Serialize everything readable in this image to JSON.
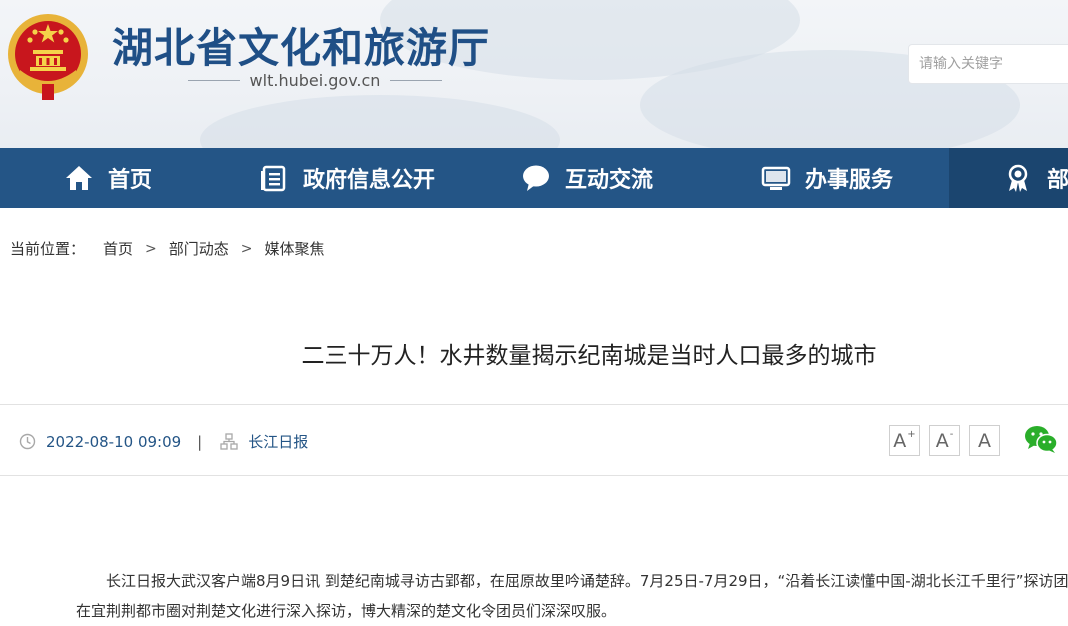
{
  "header": {
    "title": "湖北省文化和旅游厅",
    "domain": "wlt.hubei.gov.cn",
    "search_placeholder": "请输入关键字"
  },
  "nav": {
    "items": [
      {
        "label": "首页",
        "icon": "home-icon"
      },
      {
        "label": "政府信息公开",
        "icon": "document-list-icon"
      },
      {
        "label": "互动交流",
        "icon": "chat-bubble-icon"
      },
      {
        "label": "办事服务",
        "icon": "monitor-icon"
      },
      {
        "label": "部",
        "icon": "award-badge-icon"
      }
    ]
  },
  "breadcrumb": {
    "label": "当前位置：",
    "items": [
      "首页",
      "部门动态",
      "媒体聚焦"
    ],
    "separator": ">"
  },
  "article": {
    "title": "二三十万人！水井数量揭示纪南城是当时人口最多的城市",
    "datetime": "2022-08-10 09:09",
    "meta_separator": "|",
    "source": "长江日报",
    "font_controls": [
      "A",
      "A",
      "A"
    ],
    "body": "长江日报大武汉客户端8月9日讯  到楚纪南城寻访古郢都，在屈原故里吟诵楚辞。7月25日-7月29日，“沿着长江读懂中国-湖北长江千里行”探访团在宜荆荆都市圈对荆楚文化进行深入探访，博大精深的楚文化令团员们深深叹服。"
  },
  "colors": {
    "brand_blue": "#245586",
    "nav_active": "#1b456f",
    "title_blue": "#1f4f86",
    "wechat_green": "#2aae2a"
  }
}
